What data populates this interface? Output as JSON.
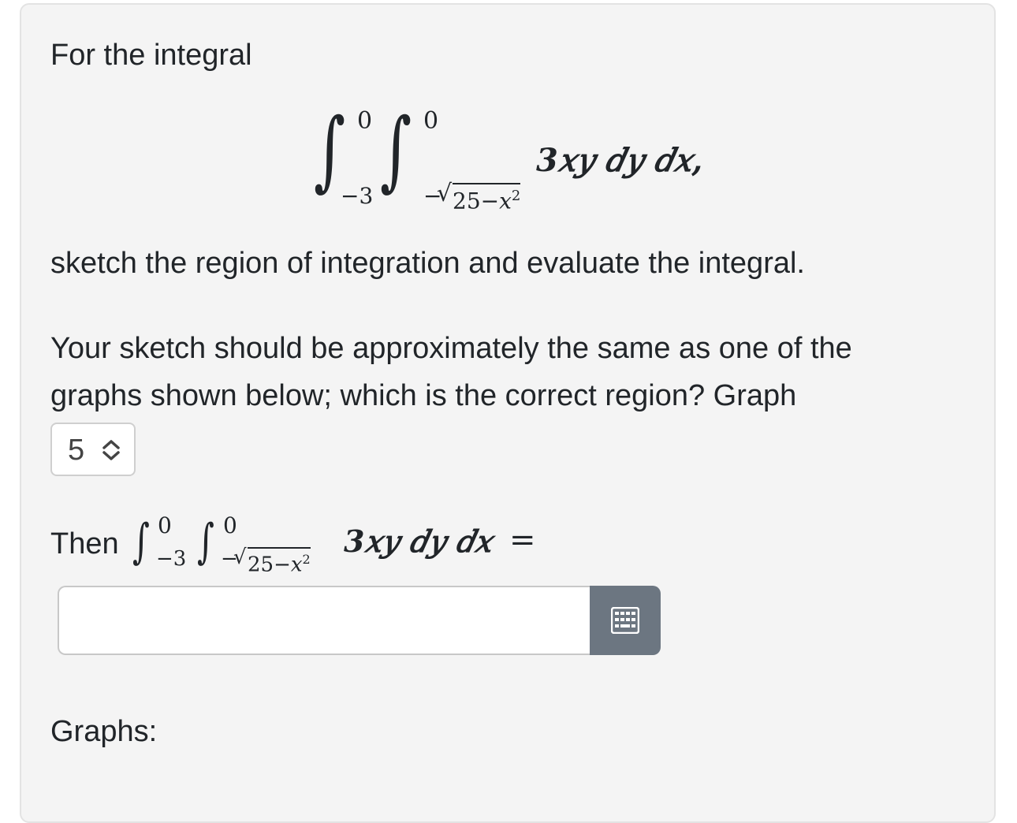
{
  "question": {
    "intro": "For the integral",
    "integral": {
      "outer_upper": "0",
      "outer_lower": "−3",
      "inner_upper": "0",
      "inner_lower_sign": "−",
      "inner_lower_radicand": "25−𝑥",
      "inner_lower_exponent": "2",
      "integrand": "3𝑥𝑦 𝑑𝑦 𝑑𝑥,"
    },
    "instruction": "sketch the region of integration and evaluate the integral.",
    "graph_prompt_line1": "Your sketch should be approximately the same as one of the",
    "graph_prompt_line2": "graphs shown below; which is the correct region? Graph",
    "graph_select_value": "5",
    "then_label": "Then",
    "then_integral": {
      "outer_upper": "0",
      "outer_lower": "−3",
      "inner_upper": "0",
      "inner_lower_sign": "−",
      "inner_lower_radicand": "25−𝑥",
      "inner_lower_exponent": "2",
      "integrand": "3𝑥𝑦 𝑑𝑦 𝑑𝑥",
      "equals": "="
    },
    "answer_value": "",
    "graphs_label": "Graphs:"
  },
  "icons": {
    "stepper": "chevron-up-down-icon",
    "keypad": "keypad-grid-icon"
  },
  "colors": {
    "card_bg": "#f4f4f4",
    "keypad_button": "#6c7681",
    "text": "#212529"
  }
}
